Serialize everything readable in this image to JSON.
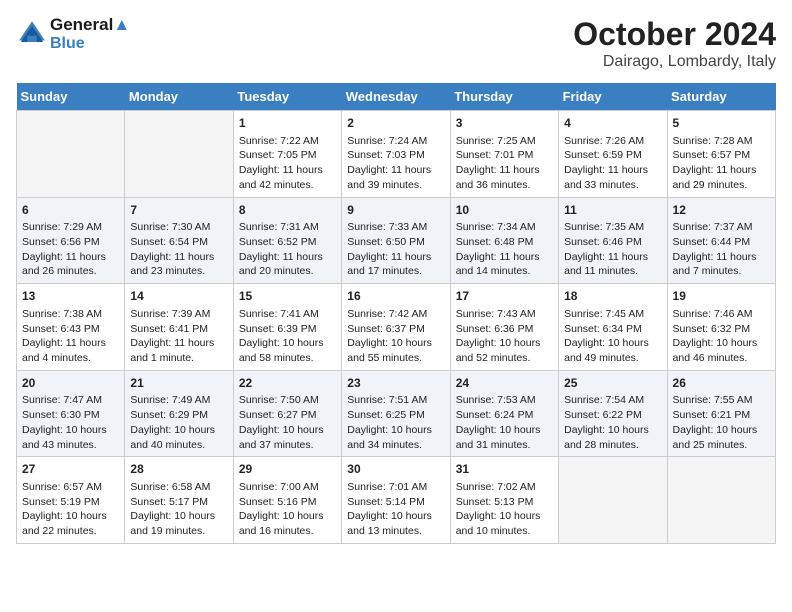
{
  "header": {
    "logo_line1": "General",
    "logo_line2": "Blue",
    "month": "October 2024",
    "location": "Dairago, Lombardy, Italy"
  },
  "weekdays": [
    "Sunday",
    "Monday",
    "Tuesday",
    "Wednesday",
    "Thursday",
    "Friday",
    "Saturday"
  ],
  "weeks": [
    [
      {
        "day": "",
        "empty": true
      },
      {
        "day": "",
        "empty": true
      },
      {
        "day": "1",
        "sunrise": "7:22 AM",
        "sunset": "7:05 PM",
        "daylight": "11 hours and 42 minutes."
      },
      {
        "day": "2",
        "sunrise": "7:24 AM",
        "sunset": "7:03 PM",
        "daylight": "11 hours and 39 minutes."
      },
      {
        "day": "3",
        "sunrise": "7:25 AM",
        "sunset": "7:01 PM",
        "daylight": "11 hours and 36 minutes."
      },
      {
        "day": "4",
        "sunrise": "7:26 AM",
        "sunset": "6:59 PM",
        "daylight": "11 hours and 33 minutes."
      },
      {
        "day": "5",
        "sunrise": "7:28 AM",
        "sunset": "6:57 PM",
        "daylight": "11 hours and 29 minutes."
      }
    ],
    [
      {
        "day": "6",
        "sunrise": "7:29 AM",
        "sunset": "6:56 PM",
        "daylight": "11 hours and 26 minutes."
      },
      {
        "day": "7",
        "sunrise": "7:30 AM",
        "sunset": "6:54 PM",
        "daylight": "11 hours and 23 minutes."
      },
      {
        "day": "8",
        "sunrise": "7:31 AM",
        "sunset": "6:52 PM",
        "daylight": "11 hours and 20 minutes."
      },
      {
        "day": "9",
        "sunrise": "7:33 AM",
        "sunset": "6:50 PM",
        "daylight": "11 hours and 17 minutes."
      },
      {
        "day": "10",
        "sunrise": "7:34 AM",
        "sunset": "6:48 PM",
        "daylight": "11 hours and 14 minutes."
      },
      {
        "day": "11",
        "sunrise": "7:35 AM",
        "sunset": "6:46 PM",
        "daylight": "11 hours and 11 minutes."
      },
      {
        "day": "12",
        "sunrise": "7:37 AM",
        "sunset": "6:44 PM",
        "daylight": "11 hours and 7 minutes."
      }
    ],
    [
      {
        "day": "13",
        "sunrise": "7:38 AM",
        "sunset": "6:43 PM",
        "daylight": "11 hours and 4 minutes."
      },
      {
        "day": "14",
        "sunrise": "7:39 AM",
        "sunset": "6:41 PM",
        "daylight": "11 hours and 1 minute."
      },
      {
        "day": "15",
        "sunrise": "7:41 AM",
        "sunset": "6:39 PM",
        "daylight": "10 hours and 58 minutes."
      },
      {
        "day": "16",
        "sunrise": "7:42 AM",
        "sunset": "6:37 PM",
        "daylight": "10 hours and 55 minutes."
      },
      {
        "day": "17",
        "sunrise": "7:43 AM",
        "sunset": "6:36 PM",
        "daylight": "10 hours and 52 minutes."
      },
      {
        "day": "18",
        "sunrise": "7:45 AM",
        "sunset": "6:34 PM",
        "daylight": "10 hours and 49 minutes."
      },
      {
        "day": "19",
        "sunrise": "7:46 AM",
        "sunset": "6:32 PM",
        "daylight": "10 hours and 46 minutes."
      }
    ],
    [
      {
        "day": "20",
        "sunrise": "7:47 AM",
        "sunset": "6:30 PM",
        "daylight": "10 hours and 43 minutes."
      },
      {
        "day": "21",
        "sunrise": "7:49 AM",
        "sunset": "6:29 PM",
        "daylight": "10 hours and 40 minutes."
      },
      {
        "day": "22",
        "sunrise": "7:50 AM",
        "sunset": "6:27 PM",
        "daylight": "10 hours and 37 minutes."
      },
      {
        "day": "23",
        "sunrise": "7:51 AM",
        "sunset": "6:25 PM",
        "daylight": "10 hours and 34 minutes."
      },
      {
        "day": "24",
        "sunrise": "7:53 AM",
        "sunset": "6:24 PM",
        "daylight": "10 hours and 31 minutes."
      },
      {
        "day": "25",
        "sunrise": "7:54 AM",
        "sunset": "6:22 PM",
        "daylight": "10 hours and 28 minutes."
      },
      {
        "day": "26",
        "sunrise": "7:55 AM",
        "sunset": "6:21 PM",
        "daylight": "10 hours and 25 minutes."
      }
    ],
    [
      {
        "day": "27",
        "sunrise": "6:57 AM",
        "sunset": "5:19 PM",
        "daylight": "10 hours and 22 minutes."
      },
      {
        "day": "28",
        "sunrise": "6:58 AM",
        "sunset": "5:17 PM",
        "daylight": "10 hours and 19 minutes."
      },
      {
        "day": "29",
        "sunrise": "7:00 AM",
        "sunset": "5:16 PM",
        "daylight": "10 hours and 16 minutes."
      },
      {
        "day": "30",
        "sunrise": "7:01 AM",
        "sunset": "5:14 PM",
        "daylight": "10 hours and 13 minutes."
      },
      {
        "day": "31",
        "sunrise": "7:02 AM",
        "sunset": "5:13 PM",
        "daylight": "10 hours and 10 minutes."
      },
      {
        "day": "",
        "empty": true
      },
      {
        "day": "",
        "empty": true
      }
    ]
  ],
  "labels": {
    "sunrise": "Sunrise:",
    "sunset": "Sunset:",
    "daylight": "Daylight:"
  },
  "colors": {
    "header_bg": "#3a7fc1",
    "alt_row": "#f0f4f8",
    "normal_row": "#ffffff"
  }
}
